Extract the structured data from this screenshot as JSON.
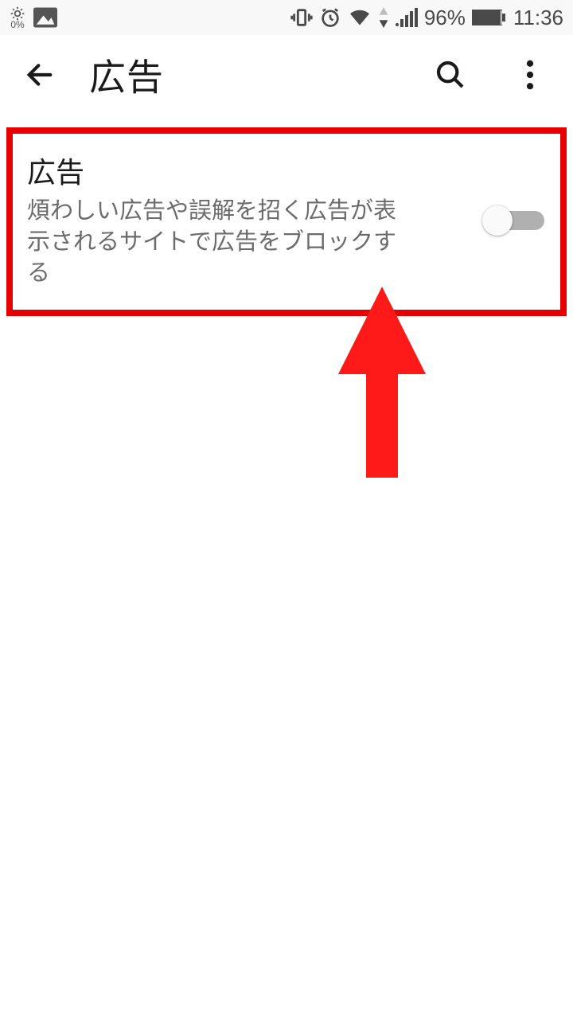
{
  "status": {
    "brightness_pct": "0%",
    "battery_pct": "96%",
    "time": "11:36"
  },
  "appbar": {
    "title": "広告"
  },
  "setting": {
    "title": "広告",
    "description": "煩わしい広告や誤解を招く広告が表示されるサイトで広告をブロックする",
    "enabled": false
  },
  "colors": {
    "highlight": "#e60000",
    "arrow": "#ff1a1a"
  }
}
